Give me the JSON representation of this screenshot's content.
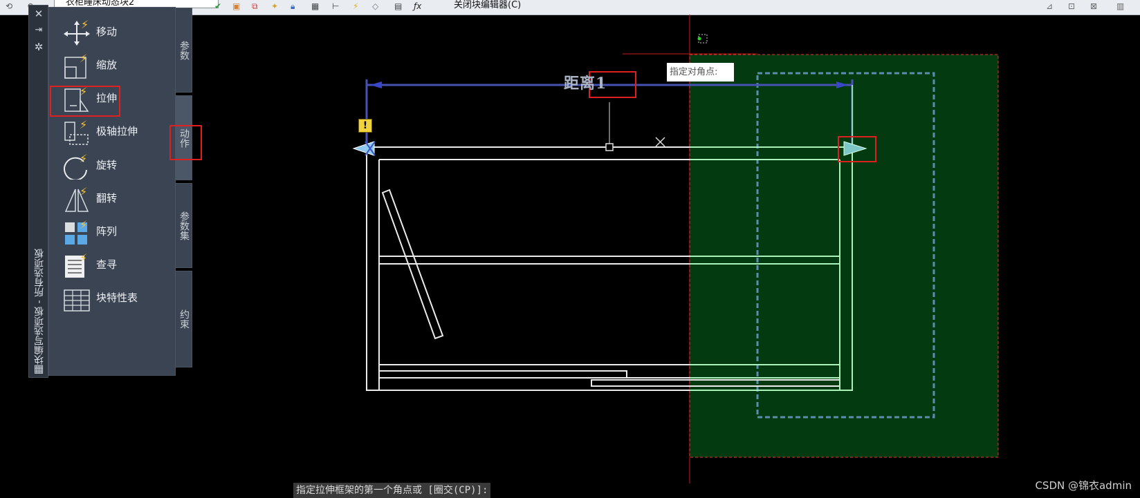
{
  "toolbar": {
    "block_name": "衣柜睡床动态块2",
    "close_editor_label": "关闭块编辑器(C)"
  },
  "palette": {
    "title": "块编写选项板 - 所有选项板",
    "tools": [
      {
        "label": "移动",
        "icon": "move-action-icon"
      },
      {
        "label": "缩放",
        "icon": "scale-action-icon"
      },
      {
        "label": "拉伸",
        "icon": "stretch-action-icon"
      },
      {
        "label": "极轴拉伸",
        "icon": "polar-stretch-action-icon"
      },
      {
        "label": "旋转",
        "icon": "rotate-action-icon"
      },
      {
        "label": "翻转",
        "icon": "flip-action-icon"
      },
      {
        "label": "阵列",
        "icon": "array-action-icon"
      },
      {
        "label": "查寻",
        "icon": "lookup-action-icon"
      },
      {
        "label": "块特性表",
        "icon": "block-properties-table-icon"
      }
    ],
    "tabs": [
      {
        "label": "参数",
        "active": false
      },
      {
        "label": "动作",
        "active": true
      },
      {
        "label": "参数集",
        "active": false
      },
      {
        "label": "约束",
        "active": false
      }
    ]
  },
  "canvas": {
    "parameter_label": "距离1",
    "tooltip": "指定对角点:",
    "command_prompt": "指定拉伸框架的第一个角点或 [圈交(CP)]:",
    "selection_fill": "#033a0f"
  },
  "watermark": "CSDN @锦衣admin"
}
